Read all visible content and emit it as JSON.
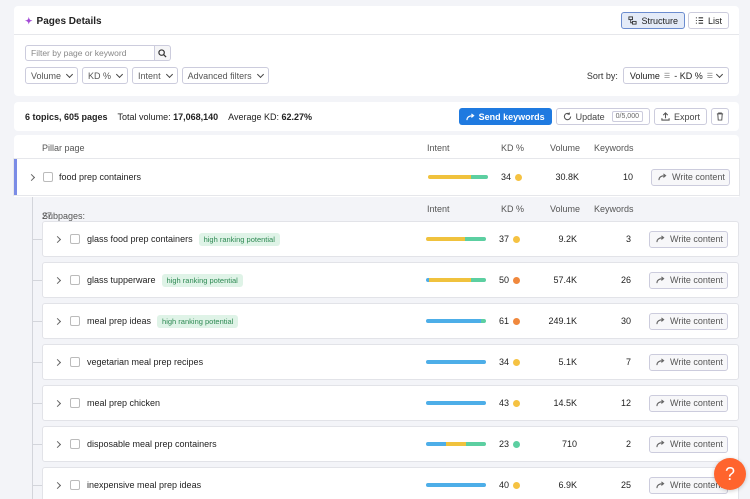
{
  "header": {
    "title": "Pages Details",
    "structure_label": "Structure",
    "list_label": "List"
  },
  "filters": {
    "search_placeholder": "Filter by page or keyword",
    "volume_label": "Volume",
    "kd_label": "KD %",
    "intent_label": "Intent",
    "advanced_label": "Advanced filters",
    "sort_by_label": "Sort by:",
    "sort_value": "Volume",
    "sort_sep": "- KD %"
  },
  "summary": {
    "topics_pages": "6 topics, 605 pages",
    "total_volume_label": "Total volume:",
    "total_volume": "17,068,140",
    "avg_kd_label": "Average KD:",
    "avg_kd": "62.27%",
    "send_keywords": "Send keywords",
    "update": "Update",
    "update_counter": "0/5,000",
    "export": "Export"
  },
  "table": {
    "pillar_col": "Pillar page",
    "intent_col": "Intent",
    "kd_col": "KD %",
    "volume_col": "Volume",
    "keywords_col": "Keywords",
    "write_content": "Write content",
    "pillar": {
      "keyword": "food prep containers",
      "kd": "34",
      "kd_color": "#f5c242",
      "volume": "30.8K",
      "keywords": "10",
      "intent": [
        {
          "color": "#f0c23d",
          "share": 0.72
        },
        {
          "color": "#5ccfa1",
          "share": 0.28
        }
      ]
    },
    "subpages_label": "Subpages:",
    "subpages_count": "27",
    "rows": [
      {
        "keyword": "glass food prep containers",
        "badge": "high ranking potential",
        "kd": "37",
        "kd_color": "#f5c242",
        "volume": "9.2K",
        "keywords": "3",
        "intent": [
          {
            "color": "#f0c23d",
            "share": 0.65
          },
          {
            "color": "#5ccfa1",
            "share": 0.35
          }
        ]
      },
      {
        "keyword": "glass tupperware",
        "badge": "high ranking potential",
        "kd": "50",
        "kd_color": "#f0883d",
        "volume": "57.4K",
        "keywords": "26",
        "intent": [
          {
            "color": "#4daee8",
            "share": 0.05
          },
          {
            "color": "#f0c23d",
            "share": 0.7
          },
          {
            "color": "#5ccfa1",
            "share": 0.25
          }
        ]
      },
      {
        "keyword": "meal prep ideas",
        "badge": "high ranking potential",
        "kd": "61",
        "kd_color": "#f0883d",
        "volume": "249.1K",
        "keywords": "30",
        "intent": [
          {
            "color": "#4daee8",
            "share": 0.92
          },
          {
            "color": "#5ccfa1",
            "share": 0.08
          }
        ]
      },
      {
        "keyword": "vegetarian meal prep recipes",
        "badge": "",
        "kd": "34",
        "kd_color": "#f5c242",
        "volume": "5.1K",
        "keywords": "7",
        "intent": [
          {
            "color": "#4daee8",
            "share": 1.0
          }
        ]
      },
      {
        "keyword": "meal prep chicken",
        "badge": "",
        "kd": "43",
        "kd_color": "#f5c242",
        "volume": "14.5K",
        "keywords": "12",
        "intent": [
          {
            "color": "#4daee8",
            "share": 1.0
          }
        ]
      },
      {
        "keyword": "disposable meal prep containers",
        "badge": "",
        "kd": "23",
        "kd_color": "#5ccfa1",
        "volume": "710",
        "keywords": "2",
        "intent": [
          {
            "color": "#4daee8",
            "share": 0.33
          },
          {
            "color": "#f0c23d",
            "share": 0.34
          },
          {
            "color": "#5ccfa1",
            "share": 0.33
          }
        ]
      },
      {
        "keyword": "inexpensive meal prep ideas",
        "badge": "",
        "kd": "40",
        "kd_color": "#f5c242",
        "volume": "6.9K",
        "keywords": "25",
        "intent": [
          {
            "color": "#4daee8",
            "share": 1.0
          }
        ]
      }
    ]
  },
  "help": {
    "label": "?"
  }
}
